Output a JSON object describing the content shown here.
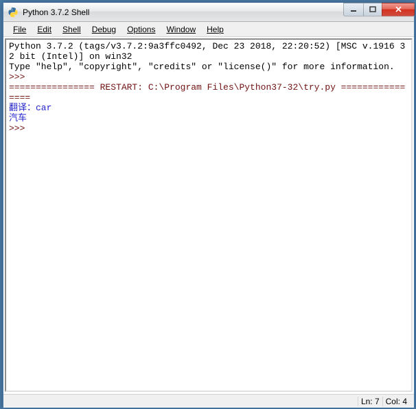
{
  "title": "Python 3.7.2 Shell",
  "menu": {
    "file": "File",
    "edit": "Edit",
    "shell": "Shell",
    "debug": "Debug",
    "options": "Options",
    "window": "Window",
    "help": "Help"
  },
  "shell": {
    "banner1": "Python 3.7.2 (tags/v3.7.2:9a3ffc0492, Dec 23 2018, 22:20:52) [MSC v.1916 32 bit (Intel)] on win32",
    "banner2": "Type \"help\", \"copyright\", \"credits\" or \"license()\" for more information.",
    "prompt1": ">>> ",
    "restart": "================ RESTART: C:\\Program Files\\Python37-32\\try.py ================",
    "line1": "翻译：car",
    "line2": "汽车",
    "prompt2": ">>> "
  },
  "status": {
    "ln": "Ln: 7",
    "col": "Col: 4"
  }
}
